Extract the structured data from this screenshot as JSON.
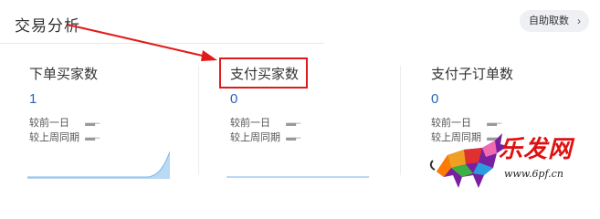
{
  "header": {
    "title": "交易分析",
    "self_fetch_label": "自助取数",
    "self_fetch_icon": "chevron-right-icon"
  },
  "cards": [
    {
      "title": "下单买家数",
      "value": "1",
      "metrics": [
        {
          "label": "较前一日",
          "value": "▬–"
        },
        {
          "label": "较上周同期",
          "value": "▬–"
        }
      ]
    },
    {
      "title": "支付买家数",
      "value": "0",
      "metrics": [
        {
          "label": "较前一日",
          "value": "▬–"
        },
        {
          "label": "较上周同期",
          "value": "▬–"
        }
      ]
    },
    {
      "title": "支付子订单数",
      "value": "0",
      "metrics": [
        {
          "label": "较前一日",
          "value": "▬–"
        },
        {
          "label": "较上周同期",
          "value": "▬–"
        }
      ]
    }
  ],
  "colors": {
    "value_blue": "#2a65b8",
    "annotation_red": "#e11b1b",
    "spark_fill": "#b9d9f5",
    "spark_line": "#7fb6e6"
  },
  "watermark": {
    "brand": "乐发网",
    "url": "www.6pf.cn"
  }
}
